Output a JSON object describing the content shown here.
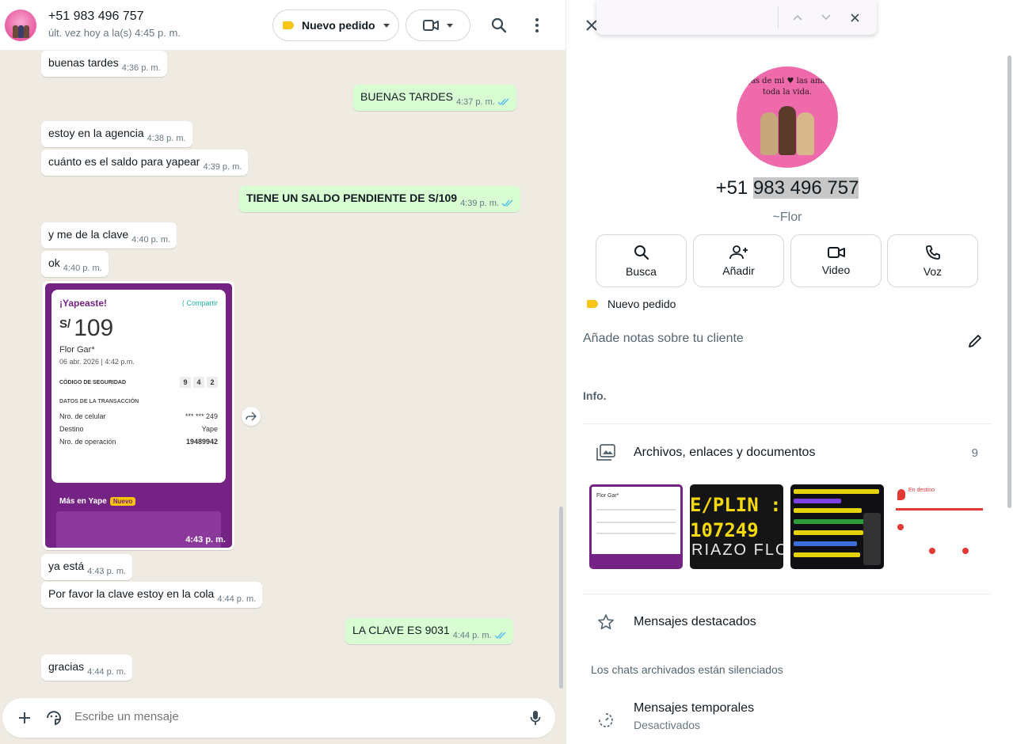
{
  "header": {
    "contact_name": "+51 983 496 757",
    "last_seen": "últ. vez hoy a la(s) 4:45 p. m.",
    "order_label": "Nuevo pedido"
  },
  "messages": [
    {
      "dir": "in",
      "text": "buenas tardes",
      "time": "4:36 p. m."
    },
    {
      "dir": "out",
      "text": "BUENAS TARDES",
      "time": "4:37 p. m."
    },
    {
      "dir": "in",
      "text": "estoy en la agencia",
      "time": "4:38 p. m."
    },
    {
      "dir": "in",
      "text": "cuánto es el saldo para yapear",
      "time": "4:39 p. m."
    },
    {
      "dir": "out",
      "text": "TIENE UN SALDO PENDIENTE DE S/109",
      "time": "4:39 p. m."
    },
    {
      "dir": "in",
      "text": "y me de la clave",
      "time": "4:40 p. m."
    },
    {
      "dir": "in",
      "text": "ok",
      "time": "4:40 p. m."
    },
    {
      "dir": "in",
      "text": "ya está",
      "time": "4:43 p. m."
    },
    {
      "dir": "in",
      "text": "Por favor la clave estoy en la cola",
      "time": "4:44 p. m."
    },
    {
      "dir": "out",
      "text": "LA CLAVE ES 9031",
      "time": "4:44 p. m."
    },
    {
      "dir": "in",
      "text": "gracias",
      "time": "4:44 p. m."
    }
  ],
  "image_message": {
    "time": "4:43 p. m.",
    "yape": {
      "title": "¡Yapeaste!",
      "share": "Compartir",
      "currency": "S/",
      "amount": "109",
      "recipient": "Flor Gar*",
      "date": "06 abr. 2026",
      "time": "4:42 p.m.",
      "security_label": "CÓDIGO DE SEGURIDAD",
      "security_digits": [
        "9",
        "4",
        "2"
      ],
      "details_label": "DATOS DE LA TRANSACCIÓN",
      "rows": [
        {
          "label": "Nro. de celular",
          "value": "*** *** 249"
        },
        {
          "label": "Destino",
          "value": "Yape"
        },
        {
          "label": "Nro. de operación",
          "value": "19489942"
        }
      ],
      "more": "Más en Yape",
      "badge": "Nuevo"
    }
  },
  "composer": {
    "placeholder": "Escribe un mensaje"
  },
  "info": {
    "phone_prefix": "+51",
    "phone_number": "983 496 757",
    "alias": "~Flor",
    "avatar_caption": "Hijas de mi ♥ las amaré toda la vida.",
    "actions": [
      "Busca",
      "Añadir",
      "Video",
      "Voz"
    ],
    "label": "Nuevo pedido",
    "notes_placeholder": "Añade notas sobre tu cliente",
    "info_heading": "Info.",
    "files_label": "Archivos, enlaces y documentos",
    "files_count": "9",
    "thumb2_text_1": "E/PLIN :",
    "thumb2_text_2": "107249",
    "thumb2_text_3": "RIAZO FLOR",
    "thumb4_text": "En destino",
    "starred_label": "Mensajes destacados",
    "archived_note": "Los chats archivados están silenciados",
    "temporary_label": "Mensajes temporales",
    "temporary_status": "Desactivados"
  },
  "colors": {
    "chat_bg": "#efeae2",
    "outgoing_bubble": "#d9fdd3",
    "incoming_bubble": "#ffffff",
    "read_ticks": "#53bdeb",
    "yape_purple": "#742284",
    "label_yellow": "#f5c518"
  }
}
